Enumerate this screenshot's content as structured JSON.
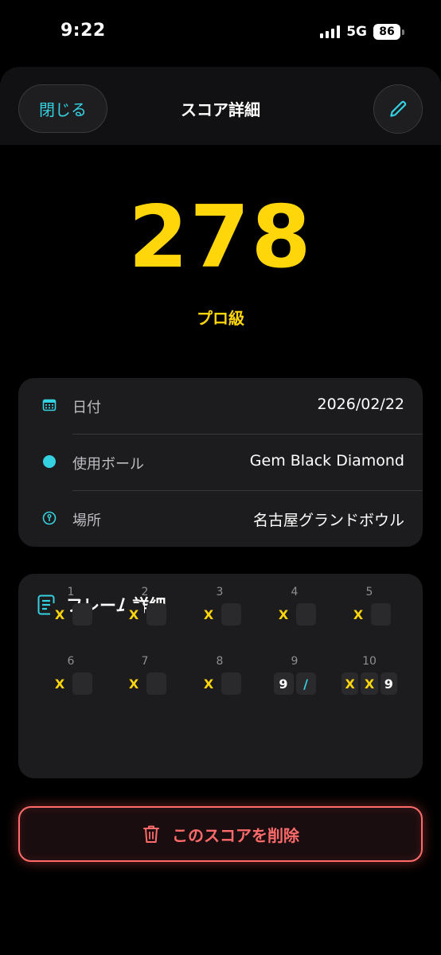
{
  "status_bar": {
    "time": "9:22",
    "network": "5G",
    "battery": "86"
  },
  "nav": {
    "close_label": "閉じる",
    "title": "スコア詳細",
    "edit_icon": "pencil-icon"
  },
  "score": {
    "value": "278",
    "rank": "プロ級"
  },
  "info": {
    "date": {
      "icon": "calendar-icon",
      "label": "日付",
      "value": "2026/02/22"
    },
    "ball": {
      "icon": "ball-dot-icon",
      "label": "使用ボール",
      "value": "Gem Black Diamond"
    },
    "location": {
      "icon": "location-icon",
      "label": "場所",
      "value": "名古屋グランドボウル"
    }
  },
  "frames": {
    "title": "フレーム詳細",
    "icon": "document-icon",
    "items": [
      {
        "num": "1",
        "rolls": [
          "X",
          ""
        ]
      },
      {
        "num": "2",
        "rolls": [
          "X",
          ""
        ]
      },
      {
        "num": "3",
        "rolls": [
          "X",
          ""
        ]
      },
      {
        "num": "4",
        "rolls": [
          "X",
          ""
        ]
      },
      {
        "num": "5",
        "rolls": [
          "X",
          ""
        ]
      },
      {
        "num": "6",
        "rolls": [
          "X",
          ""
        ]
      },
      {
        "num": "7",
        "rolls": [
          "X",
          ""
        ]
      },
      {
        "num": "8",
        "rolls": [
          "X",
          ""
        ]
      },
      {
        "num": "9",
        "rolls": [
          "9",
          "/"
        ]
      },
      {
        "num": "10",
        "rolls": [
          "X",
          "X",
          "9"
        ]
      }
    ]
  },
  "delete": {
    "label": "このスコアを削除",
    "icon": "trash-icon"
  },
  "colors": {
    "accent_cyan": "#34d1e0",
    "score_yellow": "#ffd60a",
    "danger_red": "#ff6b6b"
  }
}
